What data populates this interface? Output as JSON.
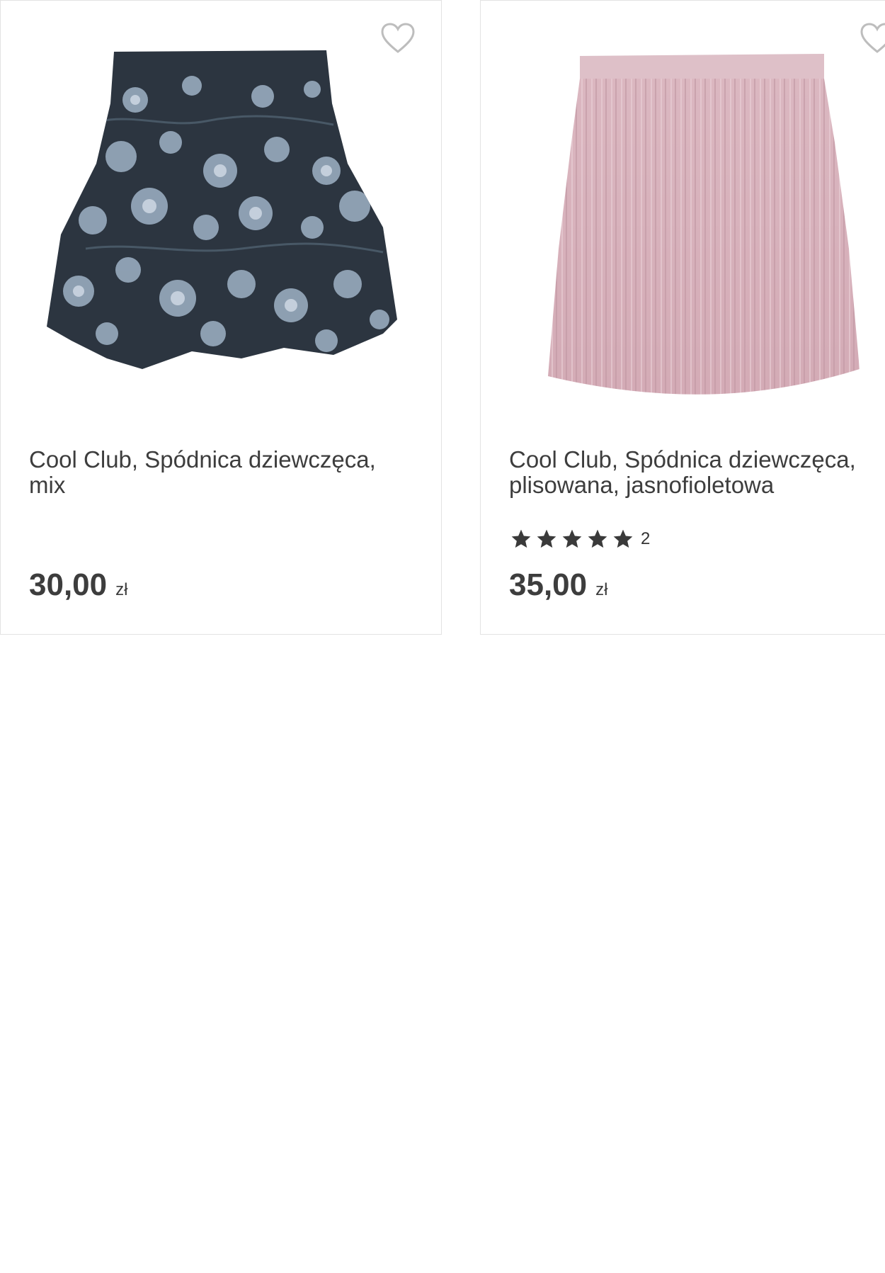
{
  "products": [
    {
      "title": "Cool Club, Spódnica dziewczęca, mix",
      "price": "30,00",
      "currency": "zł",
      "rating_count": "",
      "image": "floral-skirt"
    },
    {
      "title": "Cool Club, Spódnica dziewczęca, plisowana, jasnofioletowa",
      "price": "35,00",
      "currency": "zł",
      "rating_stars": 5,
      "rating_count": "2",
      "image": "pleated-pink-skirt"
    }
  ],
  "colors": {
    "text": "#3d3d3d",
    "border": "#e3e3e3",
    "star": "#3a3a3a",
    "heart_outline": "#bdbdbd",
    "skirt_floral_base": "#2c3540",
    "skirt_floral_flower": "#9fb2c6",
    "skirt_pink": "#d9b3bd"
  },
  "icons": {
    "favorite": "heart-outline-icon",
    "rating": "star-icon"
  }
}
